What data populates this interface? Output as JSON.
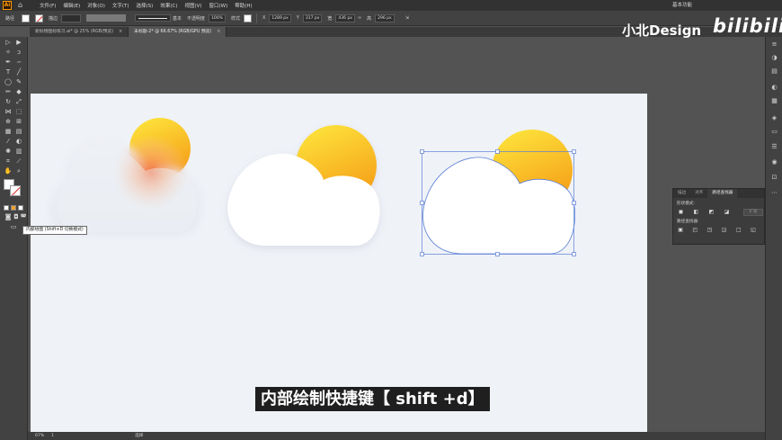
{
  "menubar": {
    "items": [
      "文件(F)",
      "编辑(E)",
      "对象(O)",
      "文字(T)",
      "选择(S)",
      "效果(C)",
      "视图(V)",
      "窗口(W)",
      "帮助(H)"
    ],
    "workspace": "基本功能"
  },
  "controlbar": {
    "object_type": "路径",
    "stroke_label": "描边",
    "stroke_profile": "基本",
    "opacity_label": "不透明度",
    "opacity_value": "100%",
    "style_label": "样式",
    "x_label": "X",
    "x_value": "1289 px",
    "y_label": "Y",
    "y_value": "317 px",
    "w_label": "宽",
    "w_value": "436 px",
    "h_label": "高",
    "h_value": "296 px"
  },
  "tabs": [
    {
      "label": "新拟物图标练习.ai* @ 25% (RGB/预览)",
      "active": false
    },
    {
      "label": "未标题-2* @ 66.67% (RGB/GPU 预览)",
      "active": true
    }
  ],
  "tooltip": "内部绘图 (Shift+D 切换模式)",
  "pathfinder": {
    "tabs": [
      "描边",
      "对齐",
      "路径查找器"
    ],
    "shape_modes_label": "形状模式:",
    "pathfinders_label": "路径查找器:",
    "expand_label": "扩展"
  },
  "statusbar": {
    "zoom": "67%",
    "page": "1",
    "tool": "选择"
  },
  "subtitle": "内部绘制快捷键【 shift +d】",
  "watermark": {
    "text": "小北Design",
    "logo": "bilibili"
  },
  "colors": {
    "sun_top": "#fde13a",
    "sun_bottom": "#f59a16",
    "cloud": "#ffffff",
    "artboard": "#eff2f7",
    "selection": "#5b7fd6"
  }
}
